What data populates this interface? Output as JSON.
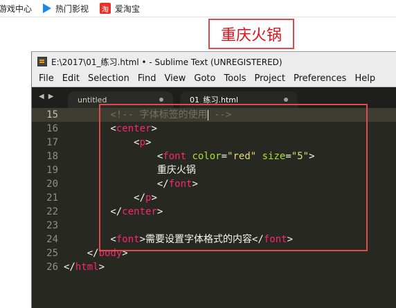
{
  "bookmarks": [
    {
      "label": "游戏中心",
      "icon": "game-center-icon"
    },
    {
      "label": "热门影视",
      "icon": "play-icon"
    },
    {
      "label": "爱淘宝",
      "icon": "taobao-icon"
    }
  ],
  "rendered_text": "重庆火锅",
  "window": {
    "title": "E:\\2017\\01_练习.html • - Sublime Text (UNREGISTERED)",
    "menu": [
      "File",
      "Edit",
      "Selection",
      "Find",
      "View",
      "Goto",
      "Tools",
      "Project",
      "Preferences",
      "Help"
    ],
    "tabs": [
      {
        "label": "untitled"
      },
      {
        "label": "01_练习.html"
      }
    ]
  },
  "code": {
    "line_numbers": [
      "15",
      "16",
      "17",
      "18",
      "19",
      "20",
      "21",
      "22",
      "23",
      "24",
      "25",
      "26"
    ],
    "lines": [
      "        <!-- 字体标签的使用 -->",
      "        <center>",
      "            <p>",
      "                <font color=\"red\" size=\"5\">",
      "                重庆火锅",
      "                </font>",
      "            </p>",
      "        </center>",
      "",
      "        <font>需要设置字体格式的内容</font>",
      "    </body>",
      "</html>"
    ]
  },
  "colors": {
    "editor_bg": "#272822",
    "tag": "#f92672",
    "attribute": "#a6e22e",
    "string": "#e6db74",
    "comment": "#75715e",
    "annotation_border": "#e14a4a",
    "rendered_text": "#e0121a"
  }
}
